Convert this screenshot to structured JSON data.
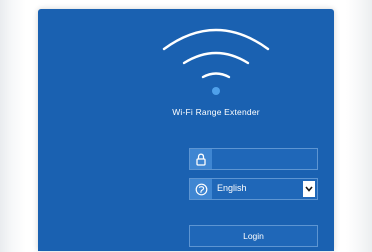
{
  "app": {
    "title": "Wi-Fi Range Extender"
  },
  "login_form": {
    "password": {
      "value": "",
      "placeholder": "",
      "icon": "lock-icon"
    },
    "language": {
      "selected": "English",
      "icon": "language-icon"
    },
    "login_label": "Login"
  },
  "colors": {
    "panel_background": "#1a61b1",
    "icon_box": "#3f86d2",
    "field_border": "#5d95d2",
    "text": "#ffffff"
  },
  "icons": {
    "wifi": "wifi-icon",
    "dropdown": "chevron-down-icon"
  }
}
